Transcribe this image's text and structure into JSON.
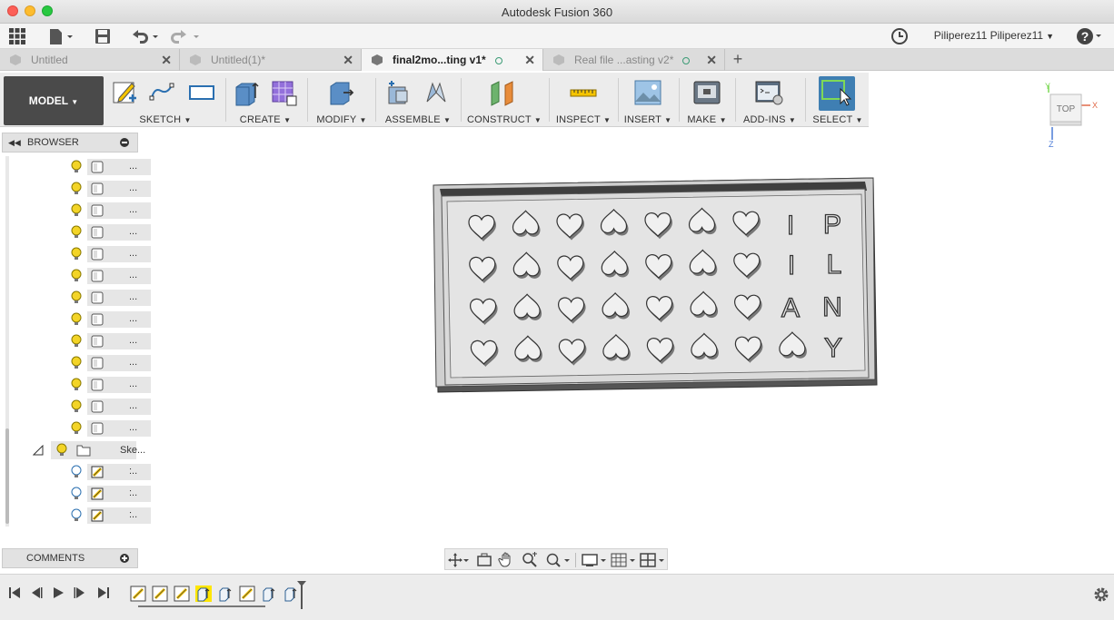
{
  "window": {
    "title": "Autodesk Fusion 360"
  },
  "user": {
    "name": "Piliperez11 Piliperez11"
  },
  "tabs": [
    {
      "label": "Untitled",
      "active": false,
      "dot": false
    },
    {
      "label": "Untitled(1)*",
      "active": false,
      "dot": false
    },
    {
      "label": "final2mo...ting v1*",
      "active": true,
      "dot": true
    },
    {
      "label": "Real file ...asting v2*",
      "active": false,
      "dot": true
    }
  ],
  "ribbon": {
    "workspace": "MODEL",
    "groups": [
      {
        "label": "SKETCH"
      },
      {
        "label": "CREATE"
      },
      {
        "label": "MODIFY"
      },
      {
        "label": "ASSEMBLE"
      },
      {
        "label": "CONSTRUCT"
      },
      {
        "label": "INSPECT"
      },
      {
        "label": "INSERT"
      },
      {
        "label": "MAKE"
      },
      {
        "label": "ADD-INS"
      },
      {
        "label": "SELECT"
      }
    ]
  },
  "viewcube": {
    "face": "TOP",
    "axis_x": "X",
    "axis_y": "Y",
    "axis_z": "Z"
  },
  "browser": {
    "title": "BROWSER",
    "body_rows": 13,
    "body_label": "...",
    "folder_label": "Ske...",
    "sketch_rows": 3,
    "sketch_label": ":.."
  },
  "comments": {
    "title": "COMMENTS"
  },
  "model": {
    "letters": [
      {
        "char": "I"
      },
      {
        "char": "P"
      },
      {
        "char": "I"
      },
      {
        "char": "L"
      },
      {
        "char": "A"
      },
      {
        "char": "N"
      },
      {
        "char": "Y"
      }
    ]
  },
  "colors": {
    "accent": "#3f7fb3",
    "highlight": "#ffe600",
    "workspace_bg": "#4a4a4a"
  }
}
